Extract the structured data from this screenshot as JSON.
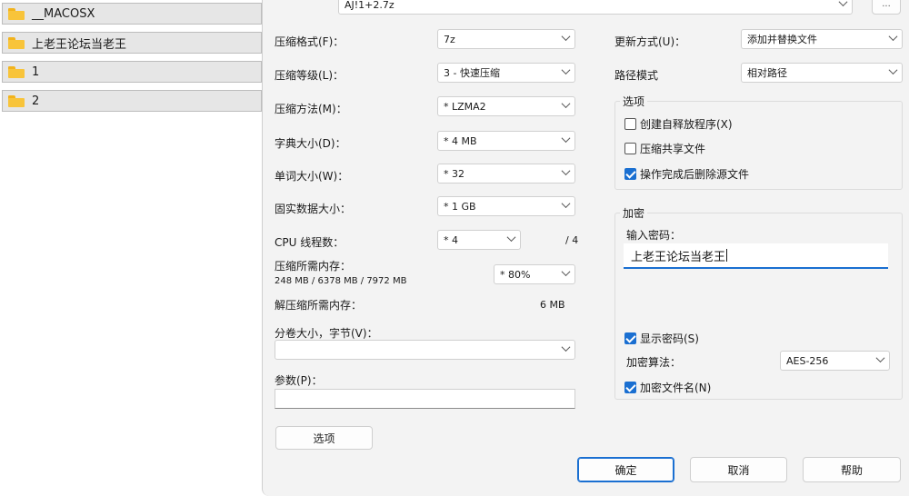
{
  "file_list": [
    {
      "name": "__MACOSX"
    },
    {
      "name": "上老王论坛当老王"
    },
    {
      "name": "1"
    },
    {
      "name": "2"
    }
  ],
  "archive": {
    "name": "AJ!1+2.7z",
    "browse_label": "..."
  },
  "left_panel": {
    "format_label": "压缩格式(F)：",
    "format_value": "7z",
    "level_label": "压缩等级(L)：",
    "level_value": "3 - 快速压缩",
    "method_label": "压缩方法(M)：",
    "method_value": "* LZMA2",
    "dict_label": "字典大小(D)：",
    "dict_value": "* 4 MB",
    "word_label": "单词大小(W)：",
    "word_value": "* 32",
    "solid_label": "固实数据大小：",
    "solid_value": "* 1 GB",
    "threads_label": "CPU 线程数：",
    "threads_value": "* 4",
    "threads_total": "/ 4",
    "mem_comp_label": "压缩所需内存：",
    "mem_comp_detail": "248 MB / 6378 MB / 7972 MB",
    "mem_comp_value": "* 80%",
    "mem_decomp_label": "解压缩所需内存：",
    "mem_decomp_value": "6 MB",
    "volume_label": "分卷大小，字节(V)：",
    "volume_value": "",
    "params_label": "参数(P)：",
    "params_value": "",
    "options_button": "选项"
  },
  "right_panel": {
    "update_label": "更新方式(U)：",
    "update_value": "添加并替换文件",
    "path_label": "路径模式",
    "path_value": "相对路径",
    "options_group": "选项",
    "opt_sfx": {
      "label": "创建自释放程序(X)",
      "checked": false
    },
    "opt_shared": {
      "label": "压缩共享文件",
      "checked": false
    },
    "opt_delete": {
      "label": "操作完成后删除源文件",
      "checked": true
    },
    "encryption_group": "加密",
    "password_label": "输入密码：",
    "password_value": "上老王论坛当老王",
    "show_password": {
      "label": "显示密码(S)",
      "checked": true
    },
    "enc_method_label": "加密算法：",
    "enc_method_value": "AES-256",
    "enc_names": {
      "label": "加密文件名(N)",
      "checked": true
    }
  },
  "buttons": {
    "ok": "确定",
    "cancel": "取消",
    "help": "帮助"
  },
  "colors": {
    "accent": "#1a6fd1",
    "dialog_bg": "#f3f3f3",
    "folder": "#f8c43a"
  }
}
